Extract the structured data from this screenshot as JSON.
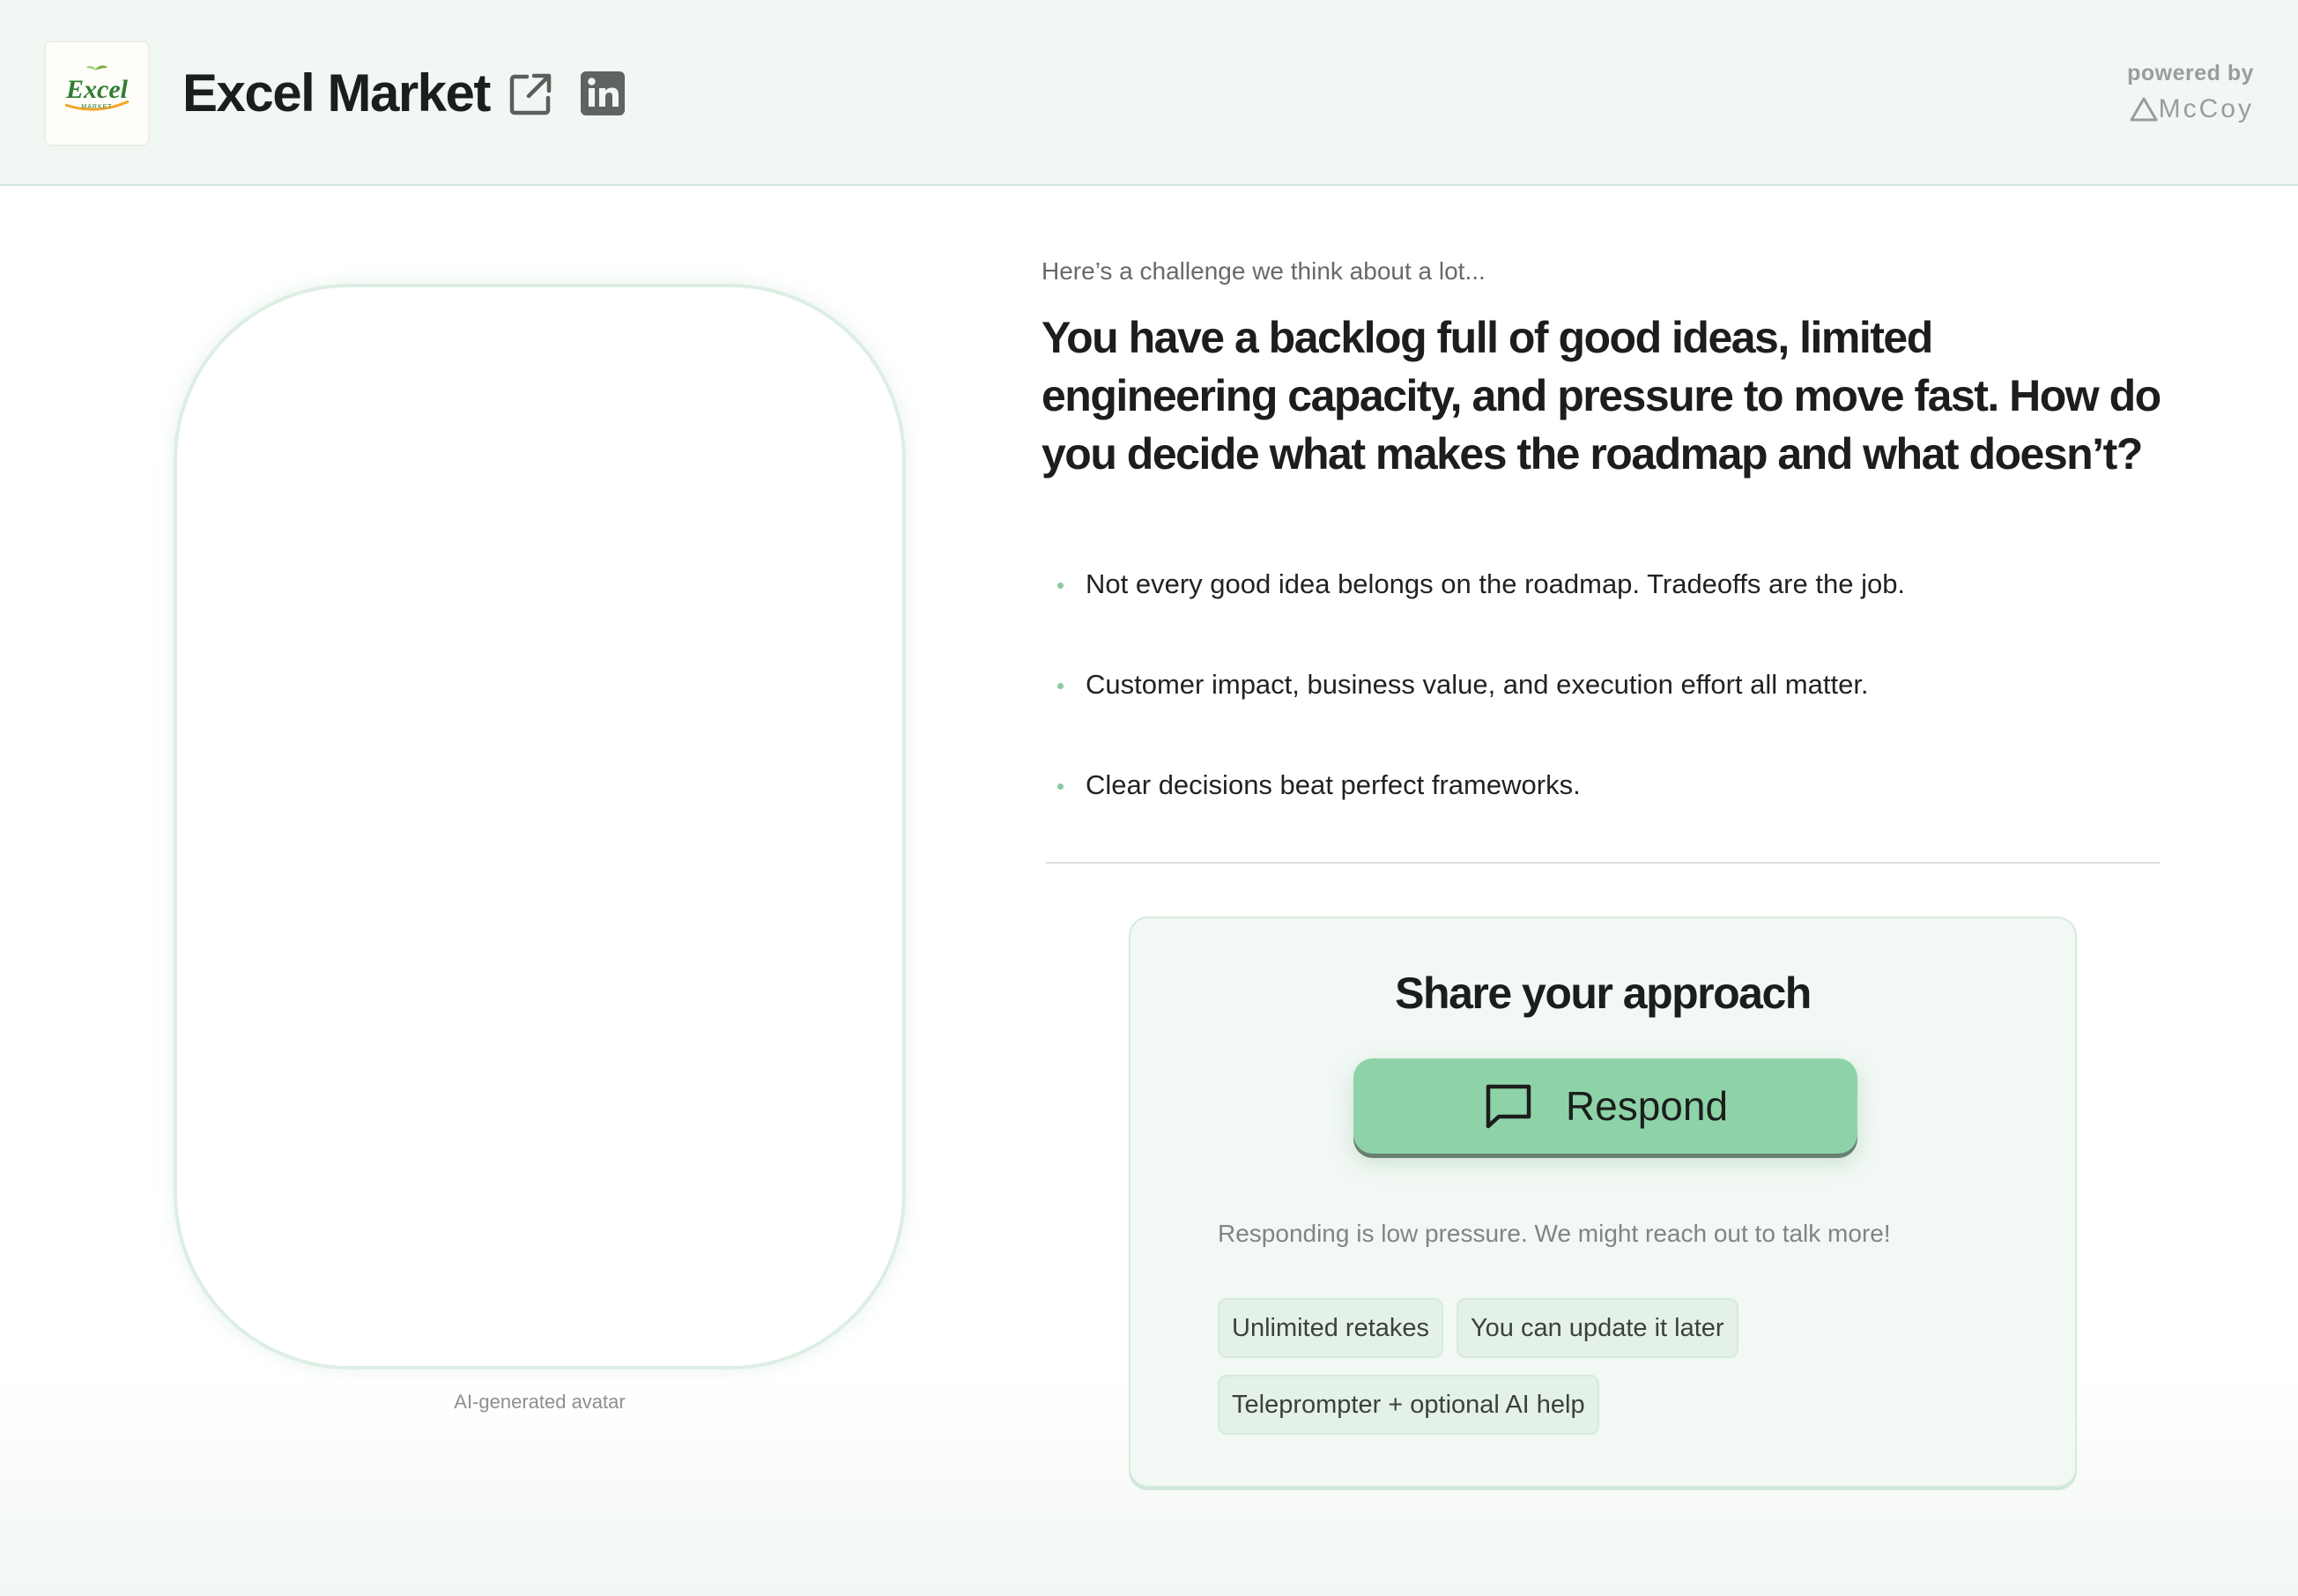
{
  "header": {
    "logo_text": "Excel",
    "logo_subtext": "MARKET",
    "company_name": "Excel Market",
    "powered_label": "powered by",
    "powered_brand": "McCoy"
  },
  "avatar": {
    "caption": "AI-generated avatar"
  },
  "challenge": {
    "intro": "Here’s a challenge we think about a lot...",
    "question": "You have a backlog full of good ideas, limited engineering capacity, and pressure to move fast. How do you decide what makes the roadmap and what doesn’t?",
    "bullets": [
      "Not every good idea belongs on the roadmap. Tradeoffs are the job.",
      "Customer impact, business value, and execution effort all matter.",
      "Clear decisions beat perfect frameworks."
    ]
  },
  "response_card": {
    "title": "Share your approach",
    "button_label": "Respond",
    "note": "Responding is low pressure. We might reach out to talk more!",
    "tags": [
      "Unlimited retakes",
      "You can update it later",
      "Teleprompter + optional AI help"
    ]
  },
  "colors": {
    "header_bg": "#f1f7f2",
    "accent": "#8ed3a8",
    "card_bg": "#f2f8f4"
  }
}
